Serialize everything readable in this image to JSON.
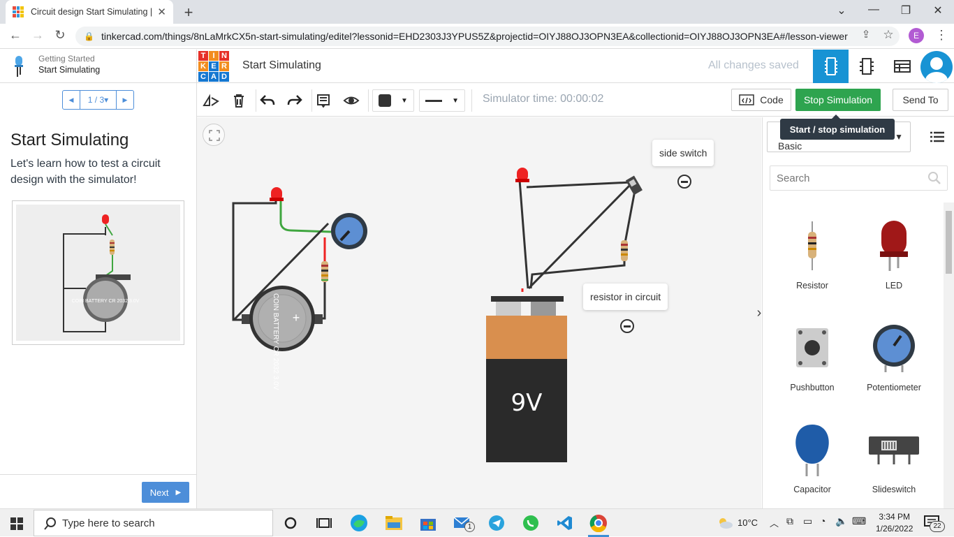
{
  "browser": {
    "tab_title": "Circuit design Start Simulating | T",
    "url": "tinkercad.com/things/8nLaMrkCX5n-start-simulating/editel?lessonid=EHD2303J3YPUS5Z&projectid=OIYJ88OJ3OPN3EA&collectionid=OIYJ88OJ3OPN3EA#/lesson-viewer",
    "profile_initial": "E"
  },
  "lesson": {
    "breadcrumb_parent": "Getting Started",
    "breadcrumb_current": "Start Simulating",
    "page_indicator": "1 / 3",
    "title": "Start Simulating",
    "description": "Let's learn how to test a circuit design with the simulator!",
    "next_label": "Next",
    "preview_battery_label": "COIN BATTERY CR 2032 3.0V"
  },
  "header": {
    "logo_letters": [
      "T",
      "I",
      "N",
      "K",
      "E",
      "R",
      "C",
      "A",
      "D"
    ],
    "title": "Start Simulating",
    "save_status": "All changes saved"
  },
  "toolbar": {
    "sim_time": "Simulator time: 00:00:02",
    "code_label": "Code",
    "stop_label": "Stop Simulation",
    "send_label": "Send To",
    "tooltip": "Start / stop simulation"
  },
  "canvas": {
    "callout_switch": "side switch",
    "callout_resistor": "resistor in circuit",
    "battery_9v_label": "9V",
    "coin_battery_label": "COIN BATTERY CR 2032 3.0V"
  },
  "panel": {
    "category_value": "Basic",
    "search_placeholder": "Search",
    "components": [
      "Resistor",
      "LED",
      "Pushbutton",
      "Potentiometer",
      "Capacitor",
      "Slideswitch"
    ]
  },
  "taskbar": {
    "search_placeholder": "Type here to search",
    "temperature": "10°C",
    "time": "3:34 PM",
    "date": "1/26/2022",
    "notif_count": "22",
    "mail_badge": "1"
  }
}
